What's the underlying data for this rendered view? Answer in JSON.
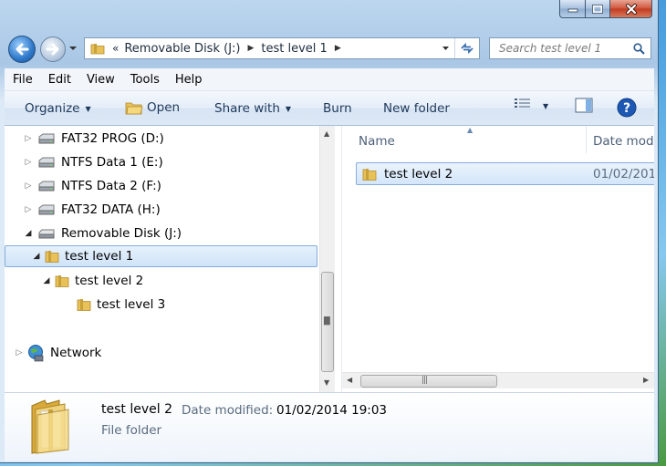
{
  "window": {
    "caption": {
      "minimize": "minimize",
      "maximize": "maximize",
      "close": "close"
    }
  },
  "address": {
    "overflow": "«",
    "segments": [
      "Removable Disk (J:)",
      "test level 1"
    ]
  },
  "search": {
    "placeholder": "Search test level 1"
  },
  "menu": [
    "File",
    "Edit",
    "View",
    "Tools",
    "Help"
  ],
  "toolbar": {
    "organize": "Organize",
    "open": "Open",
    "share_with": "Share with",
    "burn": "Burn",
    "new_folder": "New folder"
  },
  "tree": {
    "items": [
      {
        "label": "FAT32 PROG (D:)",
        "type": "drive",
        "expanded": false
      },
      {
        "label": "NTFS Data 1 (E:)",
        "type": "drive",
        "expanded": false
      },
      {
        "label": "NTFS Data 2 (F:)",
        "type": "drive",
        "expanded": false
      },
      {
        "label": "FAT32 DATA (H:)",
        "type": "drive",
        "expanded": false
      },
      {
        "label": "Removable Disk (J:)",
        "type": "drive",
        "expanded": true
      },
      {
        "label": "test level 1",
        "type": "folder",
        "expanded": true,
        "selected": true
      },
      {
        "label": "test level 2",
        "type": "folder",
        "expanded": true
      },
      {
        "label": "test level 3",
        "type": "folder",
        "expanded": false
      },
      {
        "label": "Network",
        "type": "network",
        "expanded": false
      }
    ]
  },
  "files": {
    "columns": [
      "Name",
      "Date mod"
    ],
    "rows": [
      {
        "name": "test level 2",
        "date": "01/02/201"
      }
    ]
  },
  "details": {
    "name": "test level 2",
    "modified_label": "Date modified:",
    "modified_value": "01/02/2014 19:03",
    "type": "File folder"
  },
  "colors": {
    "accent": "#1e395b",
    "selection_border": "#84acdd",
    "selection_fill": "#d4e6fa",
    "close_button": "#c23b20"
  }
}
